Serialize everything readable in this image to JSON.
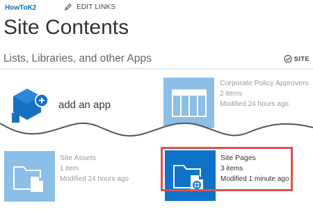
{
  "nav": {
    "home_link": "HowToK2",
    "edit_links": "EDIT LINKS"
  },
  "page": {
    "title": "Site Contents",
    "section_title": "Lists, Libraries, and other Apps",
    "site_action": "SITE"
  },
  "add_app": {
    "label": "add an app"
  },
  "apps": [
    {
      "title": "Corporate Policy Approvers",
      "count": "2 items",
      "modified": "Modified 24 hours ago",
      "icon": "list-icon"
    },
    {
      "title": "Site Assets",
      "count": "1 item",
      "modified": "Modified 24 hours ago",
      "icon": "document-library-icon"
    },
    {
      "title": "Site Pages",
      "count": "3 items",
      "modified": "Modified 1 minute ago",
      "icon": "site-pages-icon"
    }
  ],
  "colors": {
    "accent": "#0072c6",
    "tile_light": "#8cbfe7",
    "tile_dark": "#0f72c9",
    "highlight": "#d9534f"
  }
}
